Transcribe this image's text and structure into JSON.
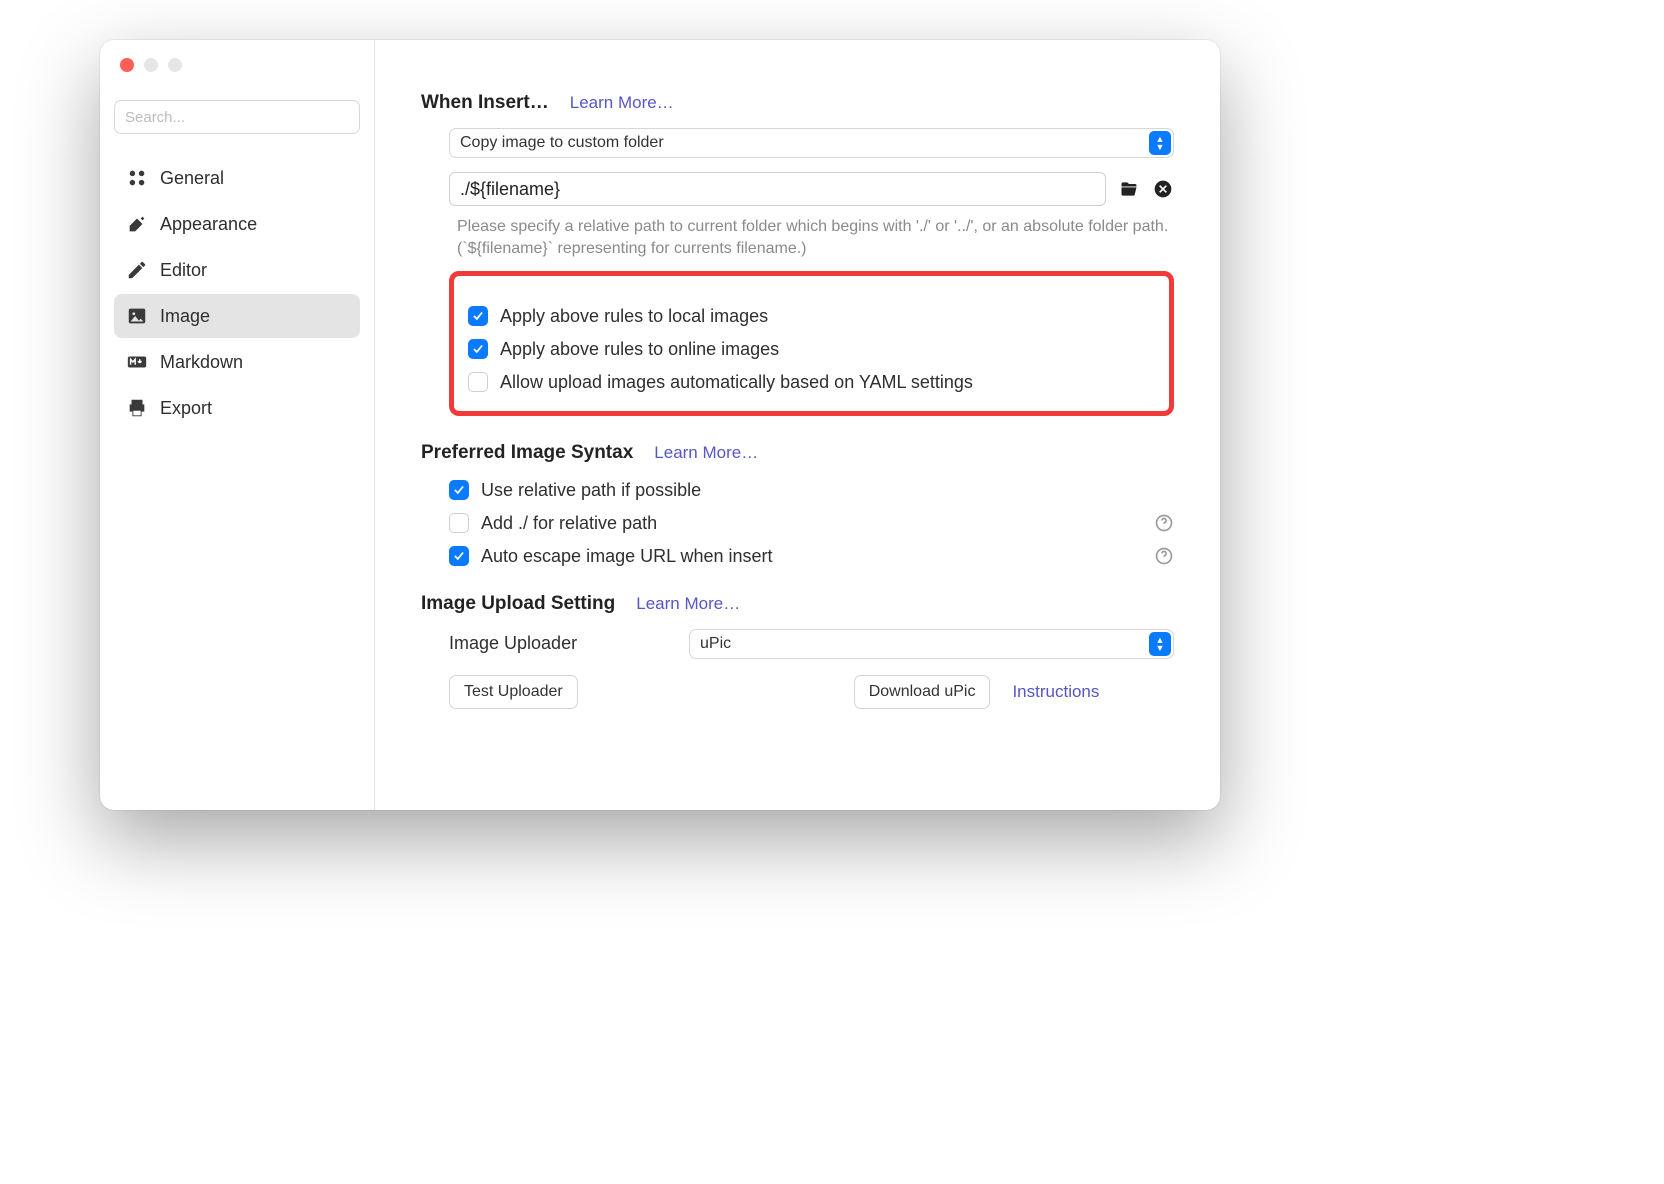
{
  "sidebar": {
    "search_placeholder": "Search...",
    "items": [
      {
        "label": "General",
        "icon": "grid-icon"
      },
      {
        "label": "Appearance",
        "icon": "paint-icon"
      },
      {
        "label": "Editor",
        "icon": "pencil-icon"
      },
      {
        "label": "Image",
        "icon": "image-icon",
        "selected": true
      },
      {
        "label": "Markdown",
        "icon": "markdown-icon"
      },
      {
        "label": "Export",
        "icon": "printer-icon"
      }
    ]
  },
  "insert": {
    "title": "When Insert…",
    "learn": "Learn More…",
    "action_selected": "Copy image to custom folder",
    "path_value": "./${filename}",
    "helper": "Please specify a relative path to current folder which begins with './' or '../', or an absolute folder path. (`${filename}` representing for currents filename.)",
    "rules": [
      {
        "label": "Apply above rules to local images",
        "checked": true
      },
      {
        "label": "Apply above rules to online images",
        "checked": true
      },
      {
        "label": "Allow upload images automatically based on YAML settings",
        "checked": false
      }
    ]
  },
  "syntax": {
    "title": "Preferred Image Syntax",
    "learn": "Learn More…",
    "options": [
      {
        "label": "Use relative path if possible",
        "checked": true,
        "help": false
      },
      {
        "label": "Add ./ for relative path",
        "checked": false,
        "help": true
      },
      {
        "label": "Auto escape image URL when insert",
        "checked": true,
        "help": true
      }
    ]
  },
  "upload": {
    "title": "Image Upload Setting",
    "learn": "Learn More…",
    "uploader_label": "Image Uploader",
    "uploader_selected": "uPic",
    "test_btn": "Test Uploader",
    "download_btn": "Download uPic",
    "instructions": "Instructions"
  }
}
